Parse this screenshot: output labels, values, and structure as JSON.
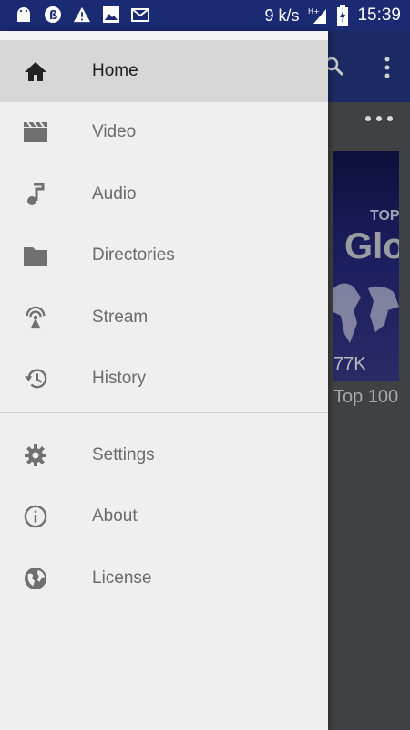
{
  "status_bar": {
    "speed": "9 k/s",
    "time": "15:39",
    "network": "H+",
    "icons": [
      "android-icon",
      "b-circle-icon",
      "warning-icon",
      "image-icon",
      "mail-icon",
      "signal-icon",
      "battery-charging-icon"
    ]
  },
  "background": {
    "thumbnail_text_top": "TOP",
    "thumbnail_text_main": "Glo",
    "thumbnail_views": "77K",
    "thumbnail_title": "Top 100"
  },
  "drawer": {
    "items": [
      {
        "label": "Home",
        "icon": "home-icon",
        "active": true
      },
      {
        "label": "Video",
        "icon": "movie-clapper-icon"
      },
      {
        "label": "Audio",
        "icon": "music-note-icon"
      },
      {
        "label": "Directories",
        "icon": "folder-icon"
      },
      {
        "label": "Stream",
        "icon": "antenna-icon"
      },
      {
        "label": "History",
        "icon": "history-icon"
      }
    ],
    "secondary_items": [
      {
        "label": "Settings",
        "icon": "gear-icon"
      },
      {
        "label": "About",
        "icon": "info-icon"
      },
      {
        "label": "License",
        "icon": "globe-icon"
      }
    ]
  },
  "colors": {
    "status_bar": "#1a2a73",
    "app_bar": "#1b2a63",
    "drawer_bg": "#efefef",
    "active_item_bg": "#d7d7d7",
    "icon_gray": "#707070"
  }
}
